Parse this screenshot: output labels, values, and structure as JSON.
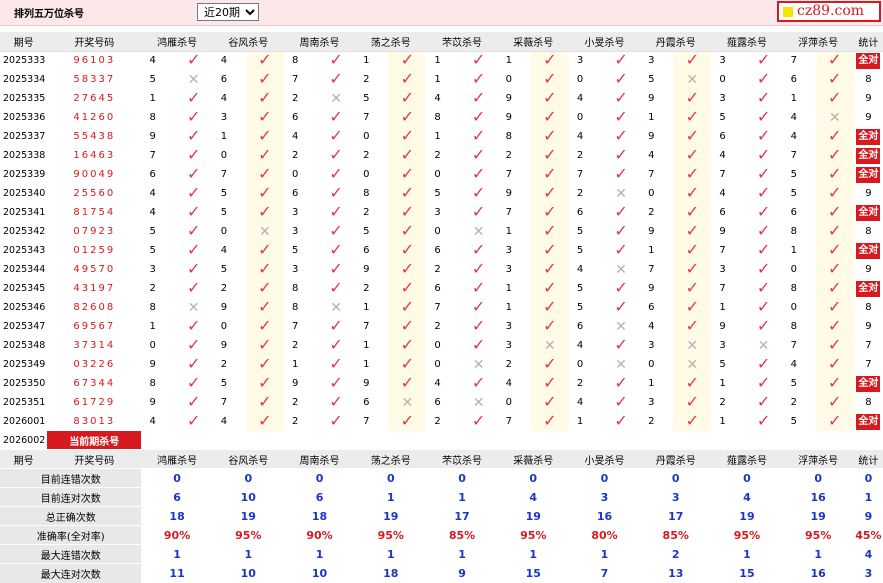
{
  "header": {
    "title": "排列五万位杀号",
    "period_selected": "近20期",
    "period_options": [
      "近20期"
    ],
    "logo_text": "cz89.com"
  },
  "columns": {
    "issue": "期号",
    "draw": "开奖号码",
    "experts": [
      "鸿雁杀号",
      "谷风杀号",
      "周南杀号",
      "荡之杀号",
      "芣苡杀号",
      "采薇杀号",
      "小旻杀号",
      "丹霞杀号",
      "薤露杀号",
      "浮萍杀号"
    ],
    "stat": "统计"
  },
  "rows": [
    {
      "issue": "2025333",
      "draw": "96103",
      "nums": [
        4,
        4,
        8,
        1,
        1,
        1,
        3,
        3,
        3,
        7
      ],
      "hits": [
        1,
        1,
        1,
        1,
        1,
        1,
        1,
        1,
        1,
        1
      ],
      "stat": "全对"
    },
    {
      "issue": "2025334",
      "draw": "58337",
      "nums": [
        5,
        6,
        7,
        2,
        1,
        0,
        0,
        5,
        0,
        6
      ],
      "hits": [
        0,
        1,
        1,
        1,
        1,
        1,
        1,
        0,
        1,
        1
      ],
      "stat": "8"
    },
    {
      "issue": "2025335",
      "draw": "27645",
      "nums": [
        1,
        4,
        2,
        5,
        4,
        9,
        4,
        9,
        3,
        1
      ],
      "hits": [
        1,
        1,
        0,
        1,
        1,
        1,
        1,
        1,
        1,
        1
      ],
      "stat": "9"
    },
    {
      "issue": "2025336",
      "draw": "41260",
      "nums": [
        8,
        3,
        6,
        7,
        8,
        9,
        0,
        1,
        5,
        4
      ],
      "hits": [
        1,
        1,
        1,
        1,
        1,
        1,
        1,
        1,
        1,
        0
      ],
      "stat": "9"
    },
    {
      "issue": "2025337",
      "draw": "55438",
      "nums": [
        9,
        1,
        4,
        0,
        1,
        8,
        4,
        9,
        6,
        4
      ],
      "hits": [
        1,
        1,
        1,
        1,
        1,
        1,
        1,
        1,
        1,
        1
      ],
      "stat": "全对"
    },
    {
      "issue": "2025338",
      "draw": "16463",
      "nums": [
        7,
        0,
        2,
        2,
        2,
        2,
        2,
        4,
        4,
        7
      ],
      "hits": [
        1,
        1,
        1,
        1,
        1,
        1,
        1,
        1,
        1,
        1
      ],
      "stat": "全对"
    },
    {
      "issue": "2025339",
      "draw": "90049",
      "nums": [
        6,
        7,
        0,
        0,
        0,
        7,
        7,
        7,
        7,
        5
      ],
      "hits": [
        1,
        1,
        1,
        1,
        1,
        1,
        1,
        1,
        1,
        1
      ],
      "stat": "全对"
    },
    {
      "issue": "2025340",
      "draw": "25560",
      "nums": [
        4,
        5,
        6,
        8,
        5,
        9,
        2,
        0,
        4,
        5
      ],
      "hits": [
        1,
        1,
        1,
        1,
        1,
        1,
        0,
        1,
        1,
        1
      ],
      "stat": "9"
    },
    {
      "issue": "2025341",
      "draw": "81754",
      "nums": [
        4,
        5,
        3,
        2,
        3,
        7,
        6,
        2,
        6,
        6
      ],
      "hits": [
        1,
        1,
        1,
        1,
        1,
        1,
        1,
        1,
        1,
        1
      ],
      "stat": "全对"
    },
    {
      "issue": "2025342",
      "draw": "07923",
      "nums": [
        5,
        0,
        3,
        5,
        0,
        1,
        5,
        9,
        9,
        8
      ],
      "hits": [
        1,
        0,
        1,
        1,
        0,
        1,
        1,
        1,
        1,
        1
      ],
      "stat": "8"
    },
    {
      "issue": "2025343",
      "draw": "01259",
      "nums": [
        5,
        4,
        5,
        6,
        6,
        3,
        5,
        1,
        7,
        1
      ],
      "hits": [
        1,
        1,
        1,
        1,
        1,
        1,
        1,
        1,
        1,
        1
      ],
      "stat": "全对"
    },
    {
      "issue": "2025344",
      "draw": "49570",
      "nums": [
        3,
        5,
        3,
        9,
        2,
        3,
        4,
        7,
        3,
        0
      ],
      "hits": [
        1,
        1,
        1,
        1,
        1,
        1,
        0,
        1,
        1,
        1
      ],
      "stat": "9"
    },
    {
      "issue": "2025345",
      "draw": "43197",
      "nums": [
        2,
        2,
        8,
        2,
        6,
        1,
        5,
        9,
        7,
        8
      ],
      "hits": [
        1,
        1,
        1,
        1,
        1,
        1,
        1,
        1,
        1,
        1
      ],
      "stat": "全对"
    },
    {
      "issue": "2025346",
      "draw": "82608",
      "nums": [
        8,
        9,
        8,
        1,
        7,
        1,
        5,
        6,
        1,
        0
      ],
      "hits": [
        0,
        1,
        0,
        1,
        1,
        1,
        1,
        1,
        1,
        1
      ],
      "stat": "8"
    },
    {
      "issue": "2025347",
      "draw": "69567",
      "nums": [
        1,
        0,
        7,
        7,
        2,
        3,
        6,
        4,
        9,
        8
      ],
      "hits": [
        1,
        1,
        1,
        1,
        1,
        1,
        0,
        1,
        1,
        1
      ],
      "stat": "9"
    },
    {
      "issue": "2025348",
      "draw": "37314",
      "nums": [
        0,
        9,
        2,
        1,
        0,
        3,
        4,
        3,
        3,
        7
      ],
      "hits": [
        1,
        1,
        1,
        1,
        1,
        0,
        1,
        0,
        0,
        1
      ],
      "stat": "7"
    },
    {
      "issue": "2025349",
      "draw": "03226",
      "nums": [
        9,
        2,
        1,
        1,
        0,
        2,
        0,
        0,
        5,
        4
      ],
      "hits": [
        1,
        1,
        1,
        1,
        0,
        1,
        0,
        0,
        1,
        1
      ],
      "stat": "7"
    },
    {
      "issue": "2025350",
      "draw": "67344",
      "nums": [
        8,
        5,
        9,
        9,
        4,
        4,
        2,
        1,
        1,
        5
      ],
      "hits": [
        1,
        1,
        1,
        1,
        1,
        1,
        1,
        1,
        1,
        1
      ],
      "stat": "全对"
    },
    {
      "issue": "2025351",
      "draw": "61729",
      "nums": [
        9,
        7,
        2,
        6,
        6,
        0,
        4,
        3,
        2,
        2
      ],
      "hits": [
        1,
        1,
        1,
        0,
        0,
        1,
        1,
        1,
        1,
        1
      ],
      "stat": "8"
    },
    {
      "issue": "2026001",
      "draw": "83013",
      "nums": [
        4,
        4,
        2,
        7,
        2,
        7,
        1,
        2,
        1,
        5
      ],
      "hits": [
        1,
        1,
        1,
        1,
        1,
        1,
        1,
        1,
        1,
        1
      ],
      "stat": "全对"
    }
  ],
  "current": {
    "issue": "2026002",
    "label": "当前期杀号",
    "preds": [
      "9",
      "2",
      "6",
      "2",
      "6",
      "1",
      "7",
      "4",
      "0",
      "1"
    ]
  },
  "stats": {
    "rows": [
      {
        "label": "目前连错次数",
        "values": [
          "0",
          "0",
          "0",
          "0",
          "0",
          "0",
          "0",
          "0",
          "0",
          "0"
        ],
        "stat": "0",
        "pct": false
      },
      {
        "label": "目前连对次数",
        "values": [
          "6",
          "10",
          "6",
          "1",
          "1",
          "4",
          "3",
          "3",
          "4",
          "16"
        ],
        "stat": "1",
        "pct": false
      },
      {
        "label": "总正确次数",
        "values": [
          "18",
          "19",
          "18",
          "19",
          "17",
          "19",
          "16",
          "17",
          "19",
          "19"
        ],
        "stat": "9",
        "pct": false
      },
      {
        "label": "准确率(全对率)",
        "values": [
          "90%",
          "95%",
          "90%",
          "95%",
          "85%",
          "95%",
          "80%",
          "85%",
          "95%",
          "95%"
        ],
        "stat": "45%",
        "pct": true
      },
      {
        "label": "最大连错次数",
        "values": [
          "1",
          "1",
          "1",
          "1",
          "1",
          "1",
          "1",
          "2",
          "1",
          "1"
        ],
        "stat": "4",
        "pct": false
      },
      {
        "label": "最大连对次数",
        "values": [
          "11",
          "10",
          "10",
          "18",
          "9",
          "15",
          "7",
          "13",
          "15",
          "16"
        ],
        "stat": "3",
        "pct": false
      }
    ]
  },
  "marks": {
    "hit": "✓",
    "miss": "✕"
  },
  "colors": {
    "accent": "#d71920",
    "header_bg": "#ececec",
    "stat_blue": "#1a35c8",
    "row_tint": "#fffbe6"
  }
}
